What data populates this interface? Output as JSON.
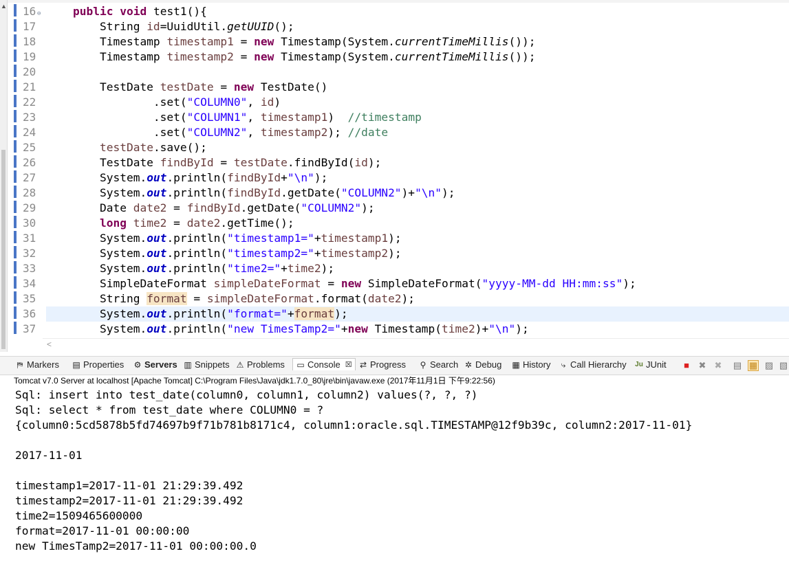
{
  "editor": {
    "lines": [
      {
        "n": "16",
        "html": "    <span class=\"kw\">public</span> <span class=\"kw\">void</span> test1(){"
      },
      {
        "n": "17",
        "html": "        String <span class=\"var\">id</span>=UuidUtil.<span class=\"it\">getUUID</span>();"
      },
      {
        "n": "18",
        "html": "        Timestamp <span class=\"var\">timestamp1</span> = <span class=\"kw\">new</span> Timestamp(System.<span class=\"it\">currentTimeMillis</span>());"
      },
      {
        "n": "19",
        "html": "        Timestamp <span class=\"var\">timestamp2</span> = <span class=\"kw\">new</span> Timestamp(System.<span class=\"it\">currentTimeMillis</span>());"
      },
      {
        "n": "20",
        "html": ""
      },
      {
        "n": "21",
        "html": "        TestDate <span class=\"var\">testDate</span> = <span class=\"kw\">new</span> TestDate()"
      },
      {
        "n": "22",
        "html": "                .set(<span class=\"str\">\"COLUMN0\"</span>, <span class=\"var\">id</span>)"
      },
      {
        "n": "23",
        "html": "                .set(<span class=\"str\">\"COLUMN1\"</span>, <span class=\"var\">timestamp1</span>)  <span class=\"cm\">//timestamp</span>"
      },
      {
        "n": "24",
        "html": "                .set(<span class=\"str\">\"COLUMN2\"</span>, <span class=\"var\">timestamp2</span>); <span class=\"cm\">//date</span>"
      },
      {
        "n": "25",
        "html": "        <span class=\"var\">testDate</span>.save();"
      },
      {
        "n": "26",
        "html": "        TestDate <span class=\"var\">findById</span> = <span class=\"var\">testDate</span>.findById(<span class=\"var\">id</span>);"
      },
      {
        "n": "27",
        "html": "        System.<span class=\"st\">out</span>.println(<span class=\"var\">findById</span>+<span class=\"str\">\"\\n\"</span>);"
      },
      {
        "n": "28",
        "html": "        System.<span class=\"st\">out</span>.println(<span class=\"var\">findById</span>.getDate(<span class=\"str\">\"COLUMN2\"</span>)+<span class=\"str\">\"\\n\"</span>);"
      },
      {
        "n": "29",
        "html": "        Date <span class=\"var\">date2</span> = <span class=\"var\">findById</span>.getDate(<span class=\"str\">\"COLUMN2\"</span>);"
      },
      {
        "n": "30",
        "html": "        <span class=\"kw\">long</span> <span class=\"var\">time2</span> = <span class=\"var\">date2</span>.getTime();"
      },
      {
        "n": "31",
        "html": "        System.<span class=\"st\">out</span>.println(<span class=\"str\">\"timestamp1=\"</span>+<span class=\"var\">timestamp1</span>);"
      },
      {
        "n": "32",
        "html": "        System.<span class=\"st\">out</span>.println(<span class=\"str\">\"timestamp2=\"</span>+<span class=\"var\">timestamp2</span>);"
      },
      {
        "n": "33",
        "html": "        System.<span class=\"st\">out</span>.println(<span class=\"str\">\"time2=\"</span>+<span class=\"var\">time2</span>);"
      },
      {
        "n": "34",
        "html": "        SimpleDateFormat <span class=\"var\">simpleDateFormat</span> = <span class=\"kw\">new</span> SimpleDateFormat(<span class=\"str\">\"yyyy-MM-dd HH:mm:ss\"</span>);"
      },
      {
        "n": "35",
        "html": "        String <span class=\"var mark\">format</span> = <span class=\"var\">simpleDateFormat</span>.format(<span class=\"var\">date2</span>);"
      },
      {
        "n": "36",
        "html": "        System.<span class=\"st\">out</span>.println(<span class=\"str\">\"format=\"</span>+<span class=\"var mark\">format</span>);",
        "hl": true
      },
      {
        "n": "37",
        "html": "        System.<span class=\"st\">out</span>.println(<span class=\"str\">\"new TimesTamp2=\"</span>+<span class=\"kw\">new</span> Timestamp(<span class=\"var\">time2</span>)+<span class=\"str\">\"\\n\"</span>);"
      }
    ]
  },
  "view_tabs": [
    {
      "label": "Markers",
      "icon": "markers-icon",
      "glyph": "⛿"
    },
    {
      "label": "Properties",
      "icon": "properties-icon",
      "glyph": "▤"
    },
    {
      "label": "Servers",
      "icon": "servers-icon",
      "glyph": "⚙",
      "bold": true
    },
    {
      "label": "Snippets",
      "icon": "snippets-icon",
      "glyph": "▥"
    },
    {
      "label": "Problems",
      "icon": "problems-icon",
      "glyph": "⚠"
    },
    {
      "label": "Console",
      "icon": "console-icon",
      "glyph": "▭",
      "active": true,
      "close": "☒"
    },
    {
      "label": "Progress",
      "icon": "progress-icon",
      "glyph": "⇄"
    },
    {
      "label": "Search",
      "icon": "search-icon",
      "glyph": "⚲"
    },
    {
      "label": "Debug",
      "icon": "debug-icon",
      "glyph": "✲"
    },
    {
      "label": "History",
      "icon": "history-icon",
      "glyph": "▦"
    },
    {
      "label": "Call Hierarchy",
      "icon": "call-hierarchy-icon",
      "glyph": "⤷"
    },
    {
      "label": "JUnit",
      "icon": "junit-icon",
      "glyph": "Ju"
    }
  ],
  "console": {
    "header": "Tomcat v7.0 Server at localhost [Apache Tomcat] C:\\Program Files\\Java\\jdk1.7.0_80\\jre\\bin\\javaw.exe (2017年11月1日 下午9:22:56)",
    "lines": [
      "Sql: insert into test_date(column0, column1, column2) values(?, ?, ?)",
      "Sql: select * from test_date where COLUMN0 = ?",
      "{column0:5cd5878b5fd74697b9f71b781b8171c4, column1:oracle.sql.TIMESTAMP@12f9b39c, column2:2017-11-01}",
      "",
      "2017-11-01",
      "",
      "timestamp1=2017-11-01 21:29:39.492",
      "timestamp2=2017-11-01 21:29:39.492",
      "time2=1509465600000",
      "format=2017-11-01 00:00:00",
      "new TimesTamp2=2017-11-01 00:00:00.0"
    ]
  },
  "colors": {
    "keyword": "#7f0055",
    "string": "#2a00ff",
    "comment": "#3f7f5f",
    "field": "#0000c0",
    "local": "#6a3e3e"
  }
}
